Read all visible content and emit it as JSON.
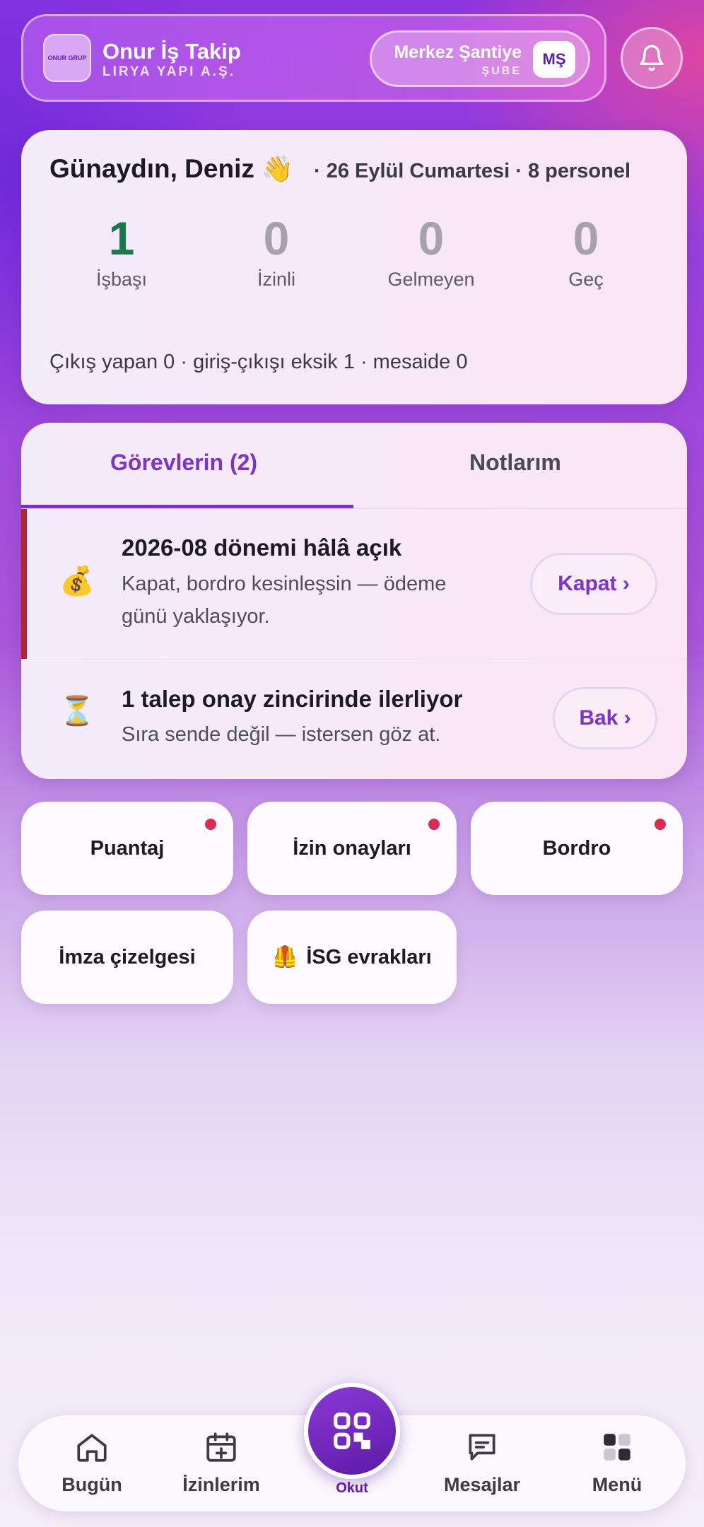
{
  "header": {
    "logo_text": "ONUR GRUP",
    "app_name": "Onur İş Takip",
    "company": "LIRYA YAPI A.Ş.",
    "branch_name": "Merkez Şantiye",
    "branch_sub": "ŞUBE",
    "branch_badge": "MŞ"
  },
  "summary": {
    "greeting": "Günaydın, Deniz",
    "greeting_emoji": "👋",
    "meta": "· 26 Eylül Cumartesi · 8 personel",
    "stats": [
      {
        "value": "1",
        "label": "İşbaşı"
      },
      {
        "value": "0",
        "label": "İzinli"
      },
      {
        "value": "0",
        "label": "Gelmeyen"
      },
      {
        "value": "0",
        "label": "Geç"
      }
    ],
    "footer": "Çıkış yapan 0 · giriş-çıkışı eksik 1 · mesaide 0"
  },
  "tabs": {
    "tasks_label": "Görevlerin (2)",
    "notes_label": "Notlarım"
  },
  "tasks": [
    {
      "icon": "💰",
      "title": "2026-08 dönemi hâlâ açık",
      "desc_line1": "Kapat, bordro kesinleşsin — ödeme",
      "desc_line2": "günü yaklaşıyor.",
      "action": "Kapat ›"
    },
    {
      "icon": "⏳",
      "title": "1 talep onay zincirinde ilerliyor",
      "desc_line1": "Sıra sende değil — istersen göz at.",
      "action": "Bak ›"
    }
  ],
  "shortcuts": [
    {
      "label": "Puantaj",
      "has_dot": true
    },
    {
      "label": "İzin onayları",
      "has_dot": true
    },
    {
      "label": "Bordro",
      "has_dot": true
    },
    {
      "label": "İmza çizelgesi",
      "has_dot": false
    },
    {
      "icon": "🦺",
      "label": "İSG evrakları",
      "has_dot": false
    }
  ],
  "nav": {
    "today": "Bugün",
    "leaves": "İzinlerim",
    "scan": "Okut",
    "messages": "Mesajlar",
    "menu": "Menü"
  },
  "colors": {
    "accent": "#7e33c8",
    "success": "#167a4a",
    "alert": "#dc2a55",
    "urgent_bar": "#b4232f"
  }
}
